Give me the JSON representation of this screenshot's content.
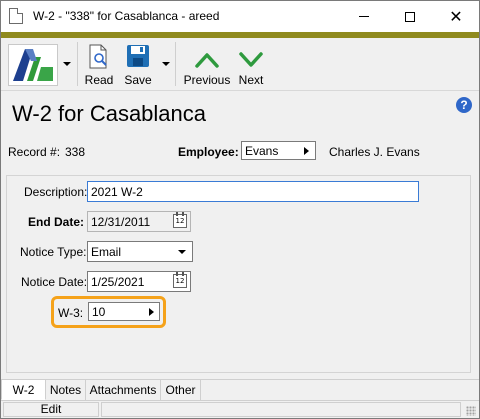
{
  "window": {
    "title": "W-2 - \"338\" for Casablanca - areed"
  },
  "toolbar": {
    "read_label": "Read",
    "save_label": "Save",
    "previous_label": "Previous",
    "next_label": "Next"
  },
  "page": {
    "title": "W-2 for Casablanca",
    "help_glyph": "?"
  },
  "record": {
    "label": "Record #:",
    "number": "338"
  },
  "employee": {
    "label": "Employee:",
    "code": "Evans",
    "name": "Charles J. Evans"
  },
  "form": {
    "description_label": "Description:",
    "description_value": "2021 W-2",
    "end_date_label": "End Date:",
    "end_date_value": "12/31/2011",
    "notice_type_label": "Notice Type:",
    "notice_type_value": "Email",
    "notice_date_label": "Notice Date:",
    "notice_date_value": "1/25/2021",
    "w3_label": "W-3:",
    "w3_value": "10"
  },
  "calendar_glyph": "12",
  "tabs": [
    "W-2",
    "Notes",
    "Attachments",
    "Other"
  ],
  "status": {
    "mode": "Edit"
  },
  "colors": {
    "accent_bar": "#8f8a1e",
    "highlight": "#f5a21a",
    "nav_green": "#2e9a3e",
    "save_blue": "#1f6fb5"
  }
}
